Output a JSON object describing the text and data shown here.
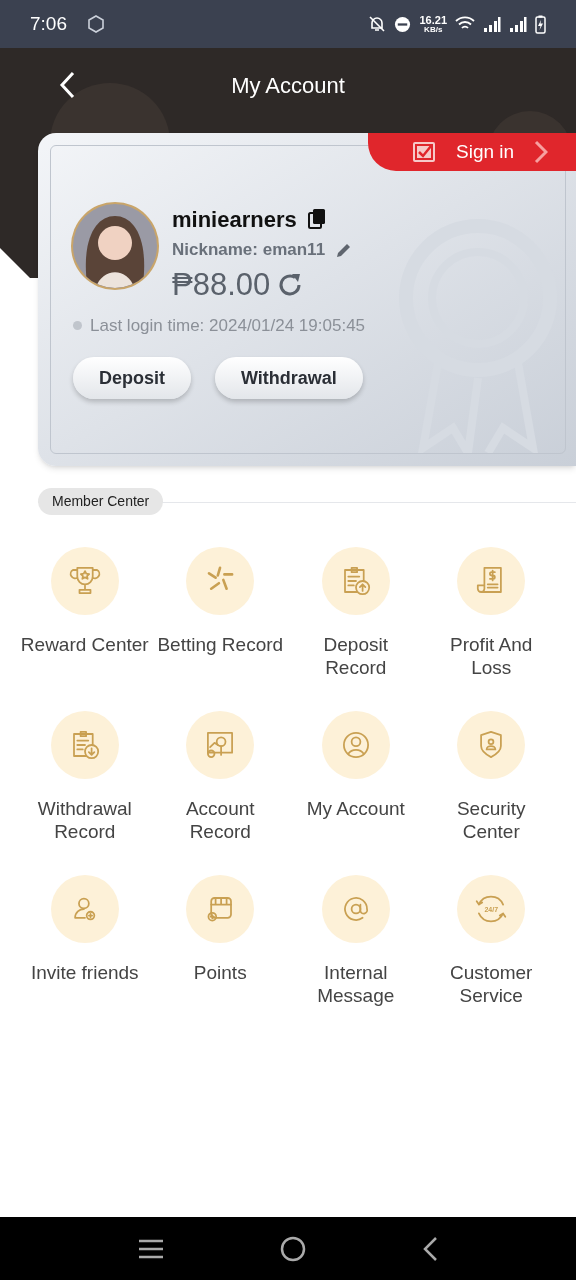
{
  "status_bar": {
    "time": "7:06",
    "speed_value": "16.21",
    "speed_unit": "KB/s"
  },
  "header": {
    "title": "My Account"
  },
  "account": {
    "sign_in": "Sign in",
    "username": "miniearners",
    "nickname": "Nickname: eman11",
    "balance": "₱88.00",
    "last_login": "Last login time: 2024/01/24 19:05:45",
    "buttons": [
      "Deposit",
      "Withdrawal"
    ]
  },
  "section_label": "Member Center",
  "menu": [
    {
      "kind": "trophy",
      "label": "Reward Center"
    },
    {
      "kind": "sparkle",
      "label": "Betting Record"
    },
    {
      "kind": "clipboard-up",
      "label": "Deposit Record"
    },
    {
      "kind": "receipt",
      "label": "Profit And Loss"
    },
    {
      "kind": "clipboard-down",
      "label": "Withdrawal Record"
    },
    {
      "kind": "monitor",
      "label": "Account Record"
    },
    {
      "kind": "person",
      "label": "My Account"
    },
    {
      "kind": "shield",
      "label": "Security Center"
    },
    {
      "kind": "invite",
      "label": "Invite friends"
    },
    {
      "kind": "shop",
      "label": "Points"
    },
    {
      "kind": "at",
      "label": "Internal Message"
    },
    {
      "kind": "cycle",
      "label": "Customer Service",
      "icon_text": "24/7"
    }
  ]
}
